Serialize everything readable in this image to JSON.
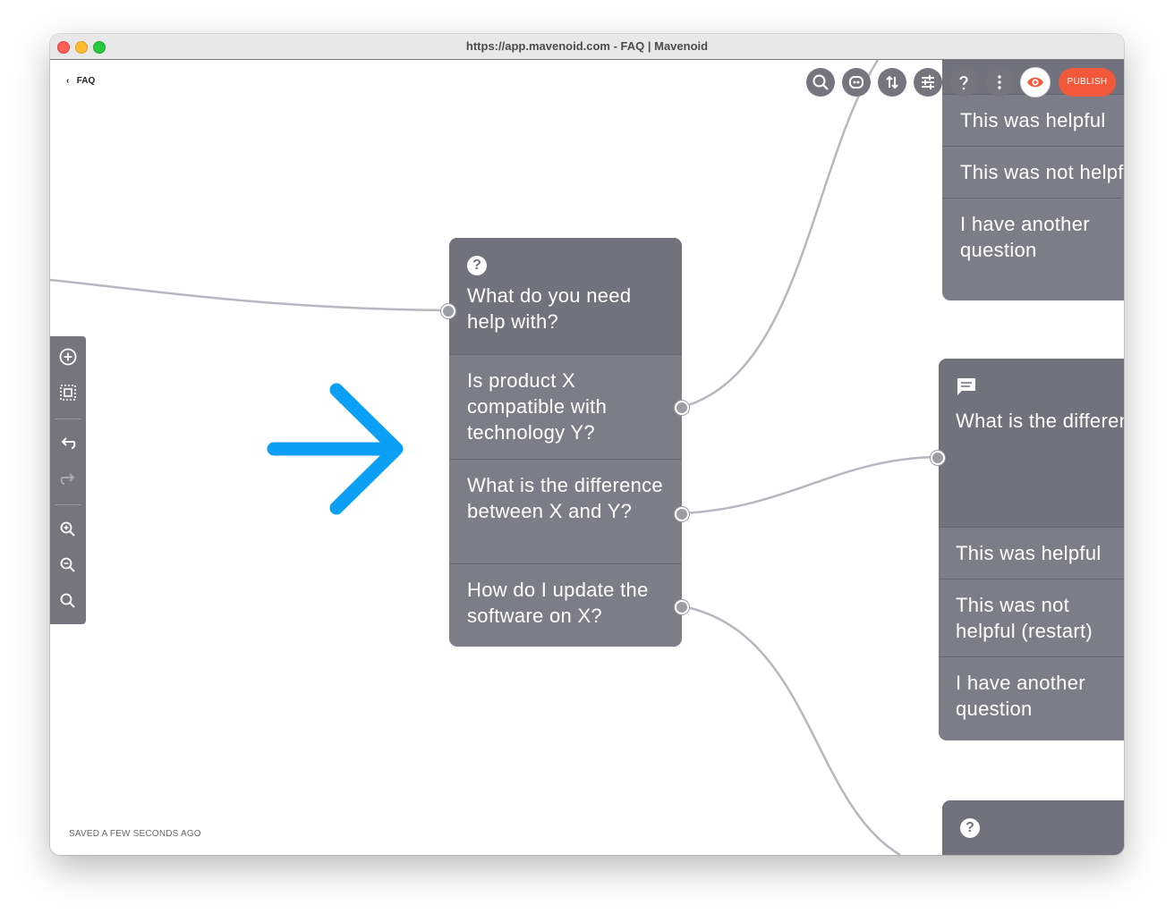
{
  "window": {
    "title": "https://app.mavenoid.com - FAQ | Mavenoid"
  },
  "header": {
    "back_label": "FAQ",
    "publish_label": "PUBLISH"
  },
  "footer": {
    "status": "SAVED A FEW SECONDS AGO"
  },
  "main_node": {
    "question": "What do you need help with?",
    "options": [
      "Is product X compatible with technology Y?",
      "What is the difference between X and Y?",
      "How do I update the software on X?"
    ]
  },
  "right_top_node": {
    "options": [
      "This was helpful",
      "This was not helpful (restart)",
      "I have another question"
    ]
  },
  "right_mid_node": {
    "question": "What is the difference between product X and product Y?",
    "options": [
      "This was helpful",
      "This was not helpful (restart)",
      "I have another question"
    ]
  },
  "colors": {
    "node": "#7d7c89",
    "node_head": "#72717e",
    "accent": "#f2593a",
    "arrow": "#0ba0f5"
  }
}
